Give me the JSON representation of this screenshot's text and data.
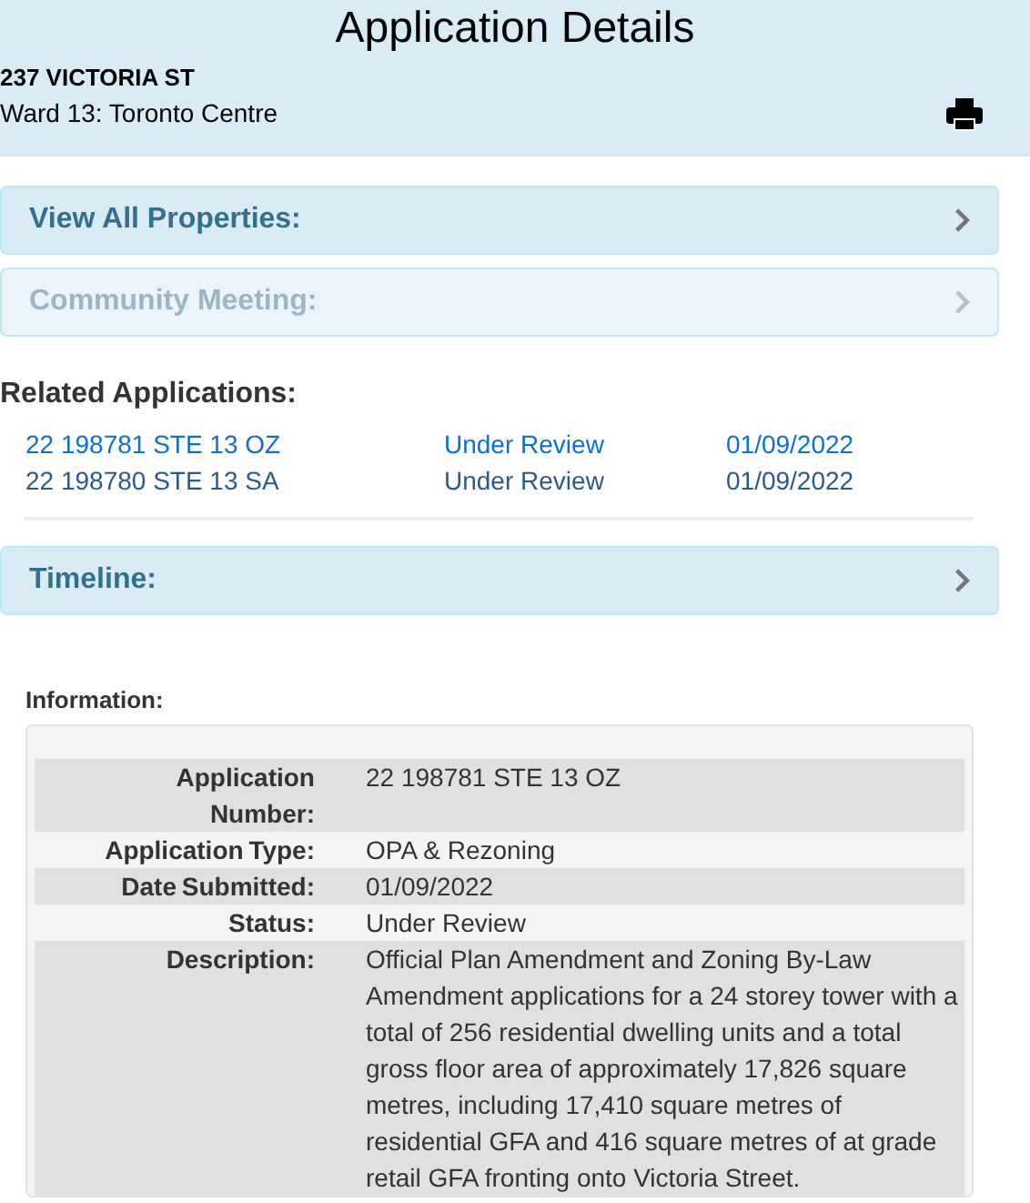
{
  "header": {
    "title": "Application Details",
    "address": "237 VICTORIA ST",
    "ward": "Ward 13: Toronto Centre"
  },
  "panels_top": [
    {
      "label": "View All Properties:",
      "disabled": false
    },
    {
      "label": "Community Meeting:",
      "disabled": true
    }
  ],
  "related": {
    "heading": "Related Applications:",
    "rows": [
      {
        "number": "22 198781 STE 13 OZ",
        "status": "Under Review",
        "date": "01/09/2022",
        "selected": true
      },
      {
        "number": "22 198780 STE 13 SA",
        "status": "Under Review",
        "date": "01/09/2022",
        "selected": false
      }
    ]
  },
  "panels_bottom": [
    {
      "label": "Timeline:",
      "disabled": false
    }
  ],
  "information": {
    "heading": "Information:",
    "rows": [
      {
        "label": "Application Number:",
        "value": "22 198781 STE 13 OZ"
      },
      {
        "label": "Application Type:",
        "value": "OPA & Rezoning"
      },
      {
        "label": "Date Submitted:",
        "value": "01/09/2022"
      },
      {
        "label": "Status:",
        "value": "Under Review"
      },
      {
        "label": "Description:",
        "value": "Official Plan Amendment and Zoning By-Law Amendment applications for a 24 storey tower with a total of 256 residential dwelling units and a total gross floor area of approximately 17,826 square metres, including 17,410 square metres of residential GFA and 416 square metres of at grade retail GFA fronting onto Victoria Street."
      }
    ]
  }
}
